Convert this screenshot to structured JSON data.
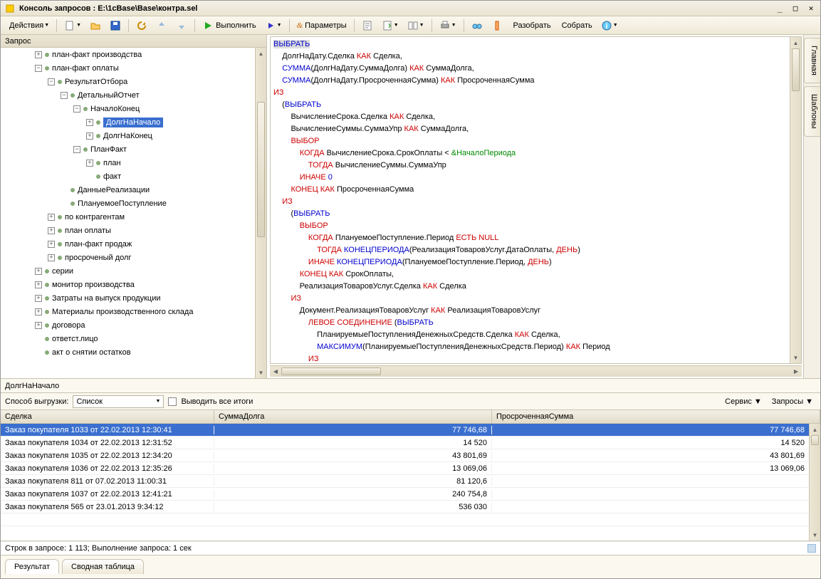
{
  "window": {
    "title": "Консоль запросов : E:\\1cBase\\Base\\контра.sel"
  },
  "toolbar": {
    "actions": "Действия",
    "run": "Выполнить",
    "params": "Параметры",
    "disasm": "Разобрать",
    "asm": "Собрать"
  },
  "tree_header": "Запрос",
  "tree": [
    {
      "d": 2,
      "e": "+",
      "t": "план-факт производства"
    },
    {
      "d": 2,
      "e": "-",
      "t": "план-факт оплаты"
    },
    {
      "d": 3,
      "e": "-",
      "t": "РезультатОтбора"
    },
    {
      "d": 4,
      "e": "-",
      "t": "ДетальныйОтчет"
    },
    {
      "d": 5,
      "e": "-",
      "t": "НачалоКонец"
    },
    {
      "d": 6,
      "e": "+",
      "t": "ДолгНаНачало",
      "sel": true
    },
    {
      "d": 6,
      "e": "+",
      "t": "ДолгНаКонец"
    },
    {
      "d": 5,
      "e": "-",
      "t": "ПланФакт"
    },
    {
      "d": 6,
      "e": "+",
      "t": "план"
    },
    {
      "d": 6,
      "e": " ",
      "t": "факт"
    },
    {
      "d": 4,
      "e": " ",
      "t": "ДанныеРеализации"
    },
    {
      "d": 4,
      "e": " ",
      "t": "ПлануемоеПоступление"
    },
    {
      "d": 3,
      "e": "+",
      "t": "по контрагентам"
    },
    {
      "d": 3,
      "e": "+",
      "t": "план оплаты"
    },
    {
      "d": 3,
      "e": "+",
      "t": "план-факт продаж"
    },
    {
      "d": 3,
      "e": "+",
      "t": "просроченый долг"
    },
    {
      "d": 2,
      "e": "+",
      "t": "серии"
    },
    {
      "d": 2,
      "e": "+",
      "t": "монитор производства"
    },
    {
      "d": 2,
      "e": "+",
      "t": "Затраты на выпуск продукции"
    },
    {
      "d": 2,
      "e": "+",
      "t": "Материалы производственного склада"
    },
    {
      "d": 2,
      "e": "+",
      "t": "договора"
    },
    {
      "d": 2,
      "e": " ",
      "t": "ответст.лицо"
    },
    {
      "d": 2,
      "e": " ",
      "t": "акт о снятии остатков"
    }
  ],
  "code_lines": [
    [
      [
        "fn sel",
        "ВЫБРАТЬ"
      ]
    ],
    [
      [
        "",
        "    ДолгНаДату.Сделка "
      ],
      [
        "kw",
        "КАК"
      ],
      [
        "",
        " Сделка,"
      ]
    ],
    [
      [
        "",
        "    "
      ],
      [
        "fn",
        "СУММА"
      ],
      [
        "",
        "(ДолгНаДату.СуммаДолга) "
      ],
      [
        "kw",
        "КАК"
      ],
      [
        "",
        " СуммаДолга,"
      ]
    ],
    [
      [
        "",
        "    "
      ],
      [
        "fn",
        "СУММА"
      ],
      [
        "",
        "(ДолгНаДату.ПросроченнаяСумма) "
      ],
      [
        "kw",
        "КАК"
      ],
      [
        "",
        " ПросроченнаяСумма"
      ]
    ],
    [
      [
        "kw",
        "ИЗ"
      ]
    ],
    [
      [
        "",
        "    ("
      ],
      [
        "fn",
        "ВЫБРАТЬ"
      ]
    ],
    [
      [
        "",
        "        ВычислениеСрока.Сделка "
      ],
      [
        "kw",
        "КАК"
      ],
      [
        "",
        " Сделка,"
      ]
    ],
    [
      [
        "",
        "        ВычислениеСуммы.СуммаУпр "
      ],
      [
        "kw",
        "КАК"
      ],
      [
        "",
        " СуммаДолга,"
      ]
    ],
    [
      [
        "",
        "        "
      ],
      [
        "kw",
        "ВЫБОР"
      ]
    ],
    [
      [
        "",
        "            "
      ],
      [
        "kw",
        "КОГДА"
      ],
      [
        "",
        " ВычислениеСрока.СрокОплаты < "
      ],
      [
        "par",
        "&НачалоПериода"
      ]
    ],
    [
      [
        "",
        "                "
      ],
      [
        "kw",
        "ТОГДА"
      ],
      [
        "",
        " ВычислениеСуммы.СуммаУпр"
      ]
    ],
    [
      [
        "",
        "            "
      ],
      [
        "kw",
        "ИНАЧЕ"
      ],
      [
        "",
        " "
      ],
      [
        "num",
        "0"
      ]
    ],
    [
      [
        "",
        "        "
      ],
      [
        "kw",
        "КОНЕЦ"
      ],
      [
        "",
        " "
      ],
      [
        "kw",
        "КАК"
      ],
      [
        "",
        " ПросроченнаяСумма"
      ]
    ],
    [
      [
        "",
        "    "
      ],
      [
        "kw",
        "ИЗ"
      ]
    ],
    [
      [
        "",
        "        ("
      ],
      [
        "fn",
        "ВЫБРАТЬ"
      ]
    ],
    [
      [
        "",
        "            "
      ],
      [
        "kw",
        "ВЫБОР"
      ]
    ],
    [
      [
        "",
        "                "
      ],
      [
        "kw",
        "КОГДА"
      ],
      [
        "",
        " ПлануемоеПоступление.Период "
      ],
      [
        "kw",
        "ЕСТЬ"
      ],
      [
        "",
        " "
      ],
      [
        "kw",
        "NULL"
      ]
    ],
    [
      [
        "",
        "                    "
      ],
      [
        "kw",
        "ТОГДА"
      ],
      [
        "",
        " "
      ],
      [
        "fn",
        "КОНЕЦПЕРИОДА"
      ],
      [
        "",
        "(РеализацияТоваровУслуг.ДатаОплаты, "
      ],
      [
        "kw",
        "ДЕНЬ"
      ],
      [
        "",
        ")"
      ]
    ],
    [
      [
        "",
        "                "
      ],
      [
        "kw",
        "ИНАЧЕ"
      ],
      [
        "",
        " "
      ],
      [
        "fn",
        "КОНЕЦПЕРИОДА"
      ],
      [
        "",
        "(ПлануемоеПоступление.Период, "
      ],
      [
        "kw",
        "ДЕНЬ"
      ],
      [
        "",
        ")"
      ]
    ],
    [
      [
        "",
        "            "
      ],
      [
        "kw",
        "КОНЕЦ"
      ],
      [
        "",
        " "
      ],
      [
        "kw",
        "КАК"
      ],
      [
        "",
        " СрокОплаты,"
      ]
    ],
    [
      [
        "",
        "            РеализацияТоваровУслуг.Сделка "
      ],
      [
        "kw",
        "КАК"
      ],
      [
        "",
        " Сделка"
      ]
    ],
    [
      [
        "",
        "        "
      ],
      [
        "kw",
        "ИЗ"
      ]
    ],
    [
      [
        "",
        "            Документ.РеализацияТоваровУслуг "
      ],
      [
        "kw",
        "КАК"
      ],
      [
        "",
        " РеализацияТоваровУслуг"
      ]
    ],
    [
      [
        "",
        "                "
      ],
      [
        "kw",
        "ЛЕВОЕ СОЕДИНЕНИЕ"
      ],
      [
        "",
        " ("
      ],
      [
        "fn",
        "ВЫБРАТЬ"
      ]
    ],
    [
      [
        "",
        "                    ПланируемыеПоступленияДенежныхСредств.Сделка "
      ],
      [
        "kw",
        "КАК"
      ],
      [
        "",
        " Сделка,"
      ]
    ],
    [
      [
        "",
        "                    "
      ],
      [
        "fn",
        "МАКСИМУМ"
      ],
      [
        "",
        "(ПланируемыеПоступленияДенежныхСредств.Период) "
      ],
      [
        "kw",
        "КАК"
      ],
      [
        "",
        " Период"
      ]
    ],
    [
      [
        "",
        "                "
      ],
      [
        "kw",
        "ИЗ"
      ]
    ]
  ],
  "side_tabs": {
    "main": "Главная",
    "tpl": "Шаблоны"
  },
  "current_label": "ДолгНаНачало",
  "opts": {
    "export_lbl": "Способ выгрузки:",
    "export_val": "Список",
    "chk_lbl": "Выводить все итоги",
    "service": "Сервис",
    "queries": "Запросы"
  },
  "grid": {
    "cols": [
      "Сделка",
      "СуммаДолга",
      "ПросроченнаяСумма"
    ],
    "rows": [
      {
        "c": [
          "Заказ покупателя 1033 от 22.02.2013 12:30:41",
          "77 746,68",
          "77 746,68"
        ],
        "sel": true
      },
      {
        "c": [
          "Заказ покупателя 1034 от 22.02.2013 12:31:52",
          "14 520",
          "14 520"
        ]
      },
      {
        "c": [
          "Заказ покупателя 1035 от 22.02.2013 12:34:20",
          "43 801,69",
          "43 801,69"
        ]
      },
      {
        "c": [
          "Заказ покупателя 1036 от 22.02.2013 12:35:26",
          "13 069,06",
          "13 069,06"
        ]
      },
      {
        "c": [
          "Заказ покупателя 811 от 07.02.2013 11:00:31",
          "81 120,6",
          ""
        ]
      },
      {
        "c": [
          "Заказ покупателя 1037 от 22.02.2013 12:41:21",
          "240 754,8",
          ""
        ]
      },
      {
        "c": [
          "Заказ покупателя 565 от 23.01.2013 9:34:12",
          "536 030",
          ""
        ]
      },
      {
        "c": [
          "",
          "",
          ""
        ]
      }
    ]
  },
  "status": "Строк в запросе: 1 113; Выполнение запроса: 1 сек",
  "tabs": {
    "result": "Результат",
    "pivot": "Сводная таблица"
  }
}
